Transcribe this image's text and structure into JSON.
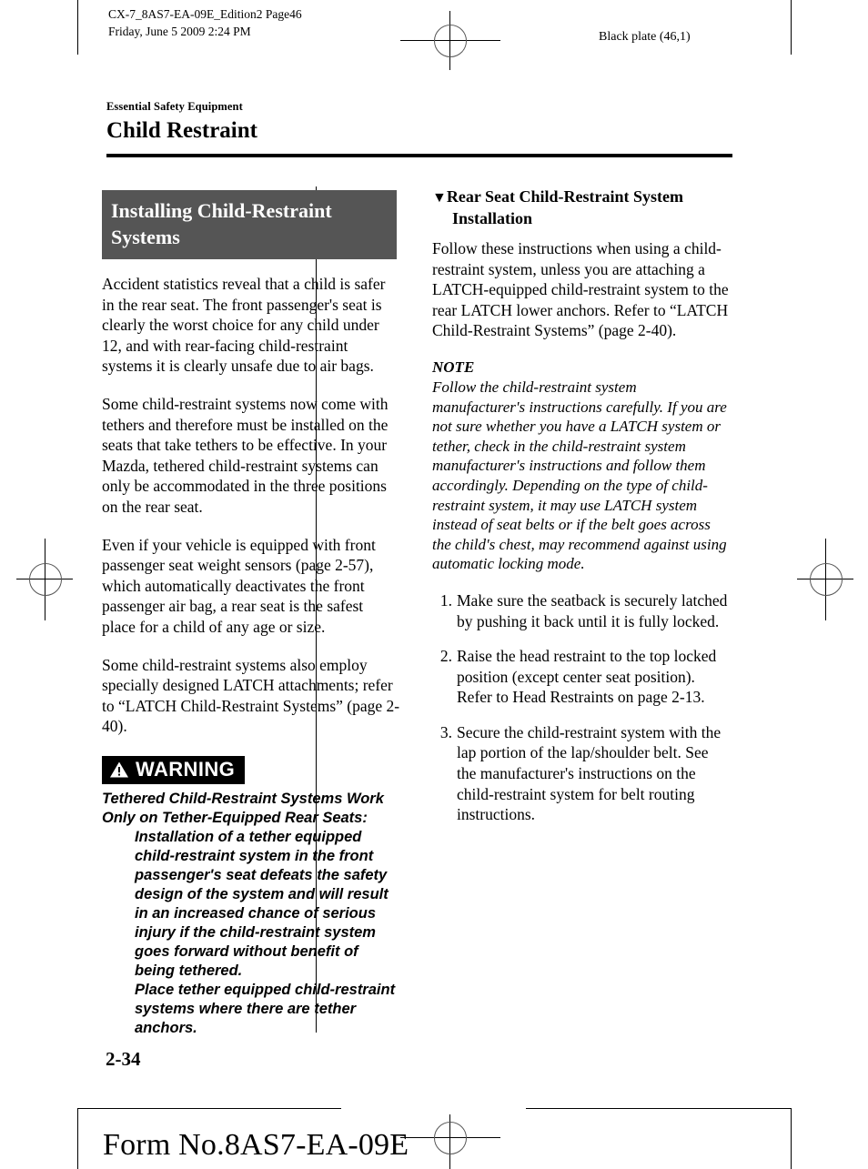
{
  "slug": {
    "left": "CX-7_8AS7-EA-09E_Edition2 Page46\nFriday, June 5 2009 2:24 PM",
    "right": "Black plate (46,1)"
  },
  "header": {
    "eyebrow": "Essential Safety Equipment",
    "title": "Child Restraint"
  },
  "left_column": {
    "section_heading": "Installing Child-Restraint Systems",
    "paragraphs": [
      "Accident statistics reveal that a child is safer in the rear seat. The front passenger's seat is clearly the worst choice for any child under 12, and with rear-facing child-restraint systems it is clearly unsafe due to air bags.",
      "Some child-restraint systems now come with tethers and therefore must be installed on the seats that take tethers to be effective. In your Mazda, tethered child-restraint systems can only be accommodated in the three positions on the rear seat.",
      "Even if your vehicle is equipped with front passenger seat weight sensors (page 2-57), which automatically deactivates the front passenger air bag, a rear seat is the safest place for a child of any age or size.",
      "Some child-restraint systems also employ specially designed LATCH attachments; refer to “LATCH Child-Restraint Systems” (page 2-40)."
    ],
    "warning": {
      "label": "WARNING",
      "icon": "warning-triangle-icon",
      "title": "Tethered Child-Restraint Systems Work Only on Tether-Equipped Rear Seats:",
      "body": "Installation of a tether equipped child-restraint system in the front passenger's seat defeats the safety design of the system and will result in an increased chance of serious injury if the child-restraint system goes forward without benefit of being tethered.\nPlace tether equipped child-restraint systems where there are tether anchors."
    }
  },
  "right_column": {
    "sub_heading_bullet": "▼",
    "sub_heading": "Rear Seat Child-Restraint System Installation",
    "intro": "Follow these instructions when using a child-restraint system, unless you are attaching a LATCH-equipped child-restraint system to the rear LATCH lower anchors. Refer to “LATCH Child-Restraint Systems” (page 2-40).",
    "note": {
      "label": "NOTE",
      "body": "Follow the child-restraint system manufacturer's instructions carefully. If you are not sure whether you have a LATCH system or tether, check in the child-restraint system manufacturer's instructions and follow them accordingly. Depending on the type of child-restraint system, it may use LATCH system instead of seat belts or if the belt goes across the child's chest, may recommend against using automatic locking mode."
    },
    "steps": [
      {
        "num": "1.",
        "text": "Make sure the seatback is securely latched by pushing it back until it is fully locked."
      },
      {
        "num": "2.",
        "text": "Raise the head restraint to the top locked position (except center seat position).\nRefer to Head Restraints on page 2-13."
      },
      {
        "num": "3.",
        "text": "Secure the child-restraint system with the lap portion of the lap/shoulder belt. See the manufacturer's instructions on the child-restraint system for belt routing instructions."
      }
    ]
  },
  "footer": {
    "folio": "2-34",
    "form_no": "Form No.8AS7-EA-09E"
  },
  "colors": {
    "section_box_bg": "#555555",
    "warning_bg": "#000000",
    "page_bg": "#ffffff",
    "text": "#000000"
  }
}
